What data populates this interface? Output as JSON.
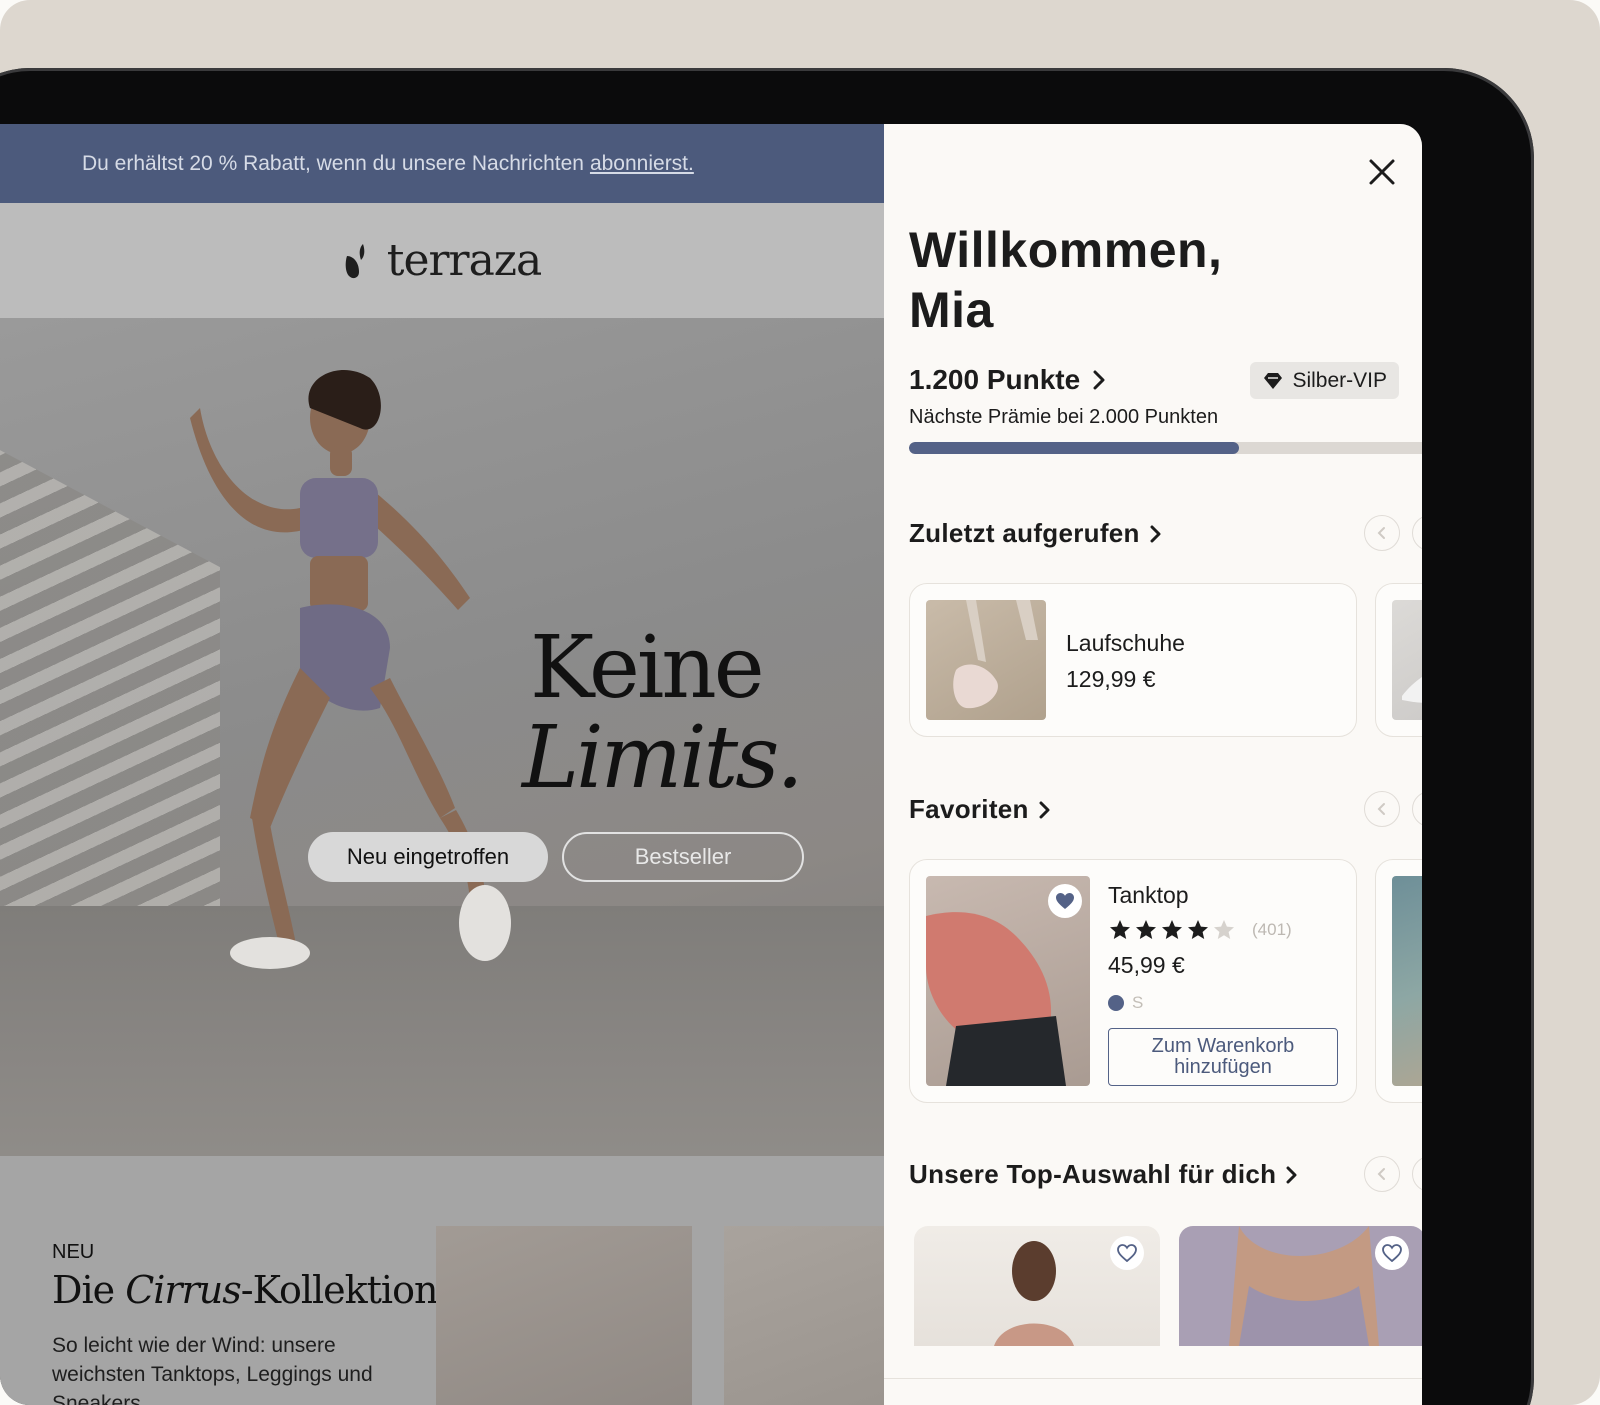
{
  "promo": {
    "text": "Du erhältst 20 % Rabatt, wenn du unsere Nachrichten",
    "link": "abonnierst."
  },
  "site": {
    "logo_text": "terraza"
  },
  "hero": {
    "headline_1": "Keine",
    "headline_2": "Limits.",
    "btn_new": "Neu eingetroffen",
    "btn_best": "Bestseller"
  },
  "collection": {
    "label": "NEU",
    "title_a": "Die ",
    "title_b": "Cirrus",
    "title_c": "-Kollektion",
    "desc": "So leicht wie der Wind: unsere weichsten Tanktops, Leggings und Sneakers"
  },
  "panel": {
    "welcome_1": "Willkommen,",
    "welcome_2": "Mia",
    "points": "1.200 Punkte",
    "vip": "Silber-VIP",
    "next_reward": "Nächste Prämie bei 2.000 Punkten",
    "progress": 0.6
  },
  "recent": {
    "title": "Zuletzt aufgerufen",
    "items": [
      {
        "name": "Laufschuhe",
        "price": "129,99 €"
      }
    ]
  },
  "favorites": {
    "title": "Favoriten",
    "items": [
      {
        "name": "Tanktop",
        "rating": 4,
        "reviews": "(401)",
        "price": "45,99 €",
        "size": "S",
        "add_to_cart": "Zum Warenkorb hinzufügen"
      }
    ]
  },
  "top_picks": {
    "title": "Unsere Top-Auswahl für dich"
  },
  "colors": {
    "accent": "#546287",
    "promo_bg": "#4c5a7c",
    "panel_bg": "#fbf9f6"
  },
  "icons": [
    "close-icon",
    "chevron-right-icon",
    "diamond-icon",
    "chevron-left-icon",
    "heart-icon",
    "star-icon",
    "home-icon",
    "orders-icon",
    "chat-icon",
    "account-icon"
  ]
}
